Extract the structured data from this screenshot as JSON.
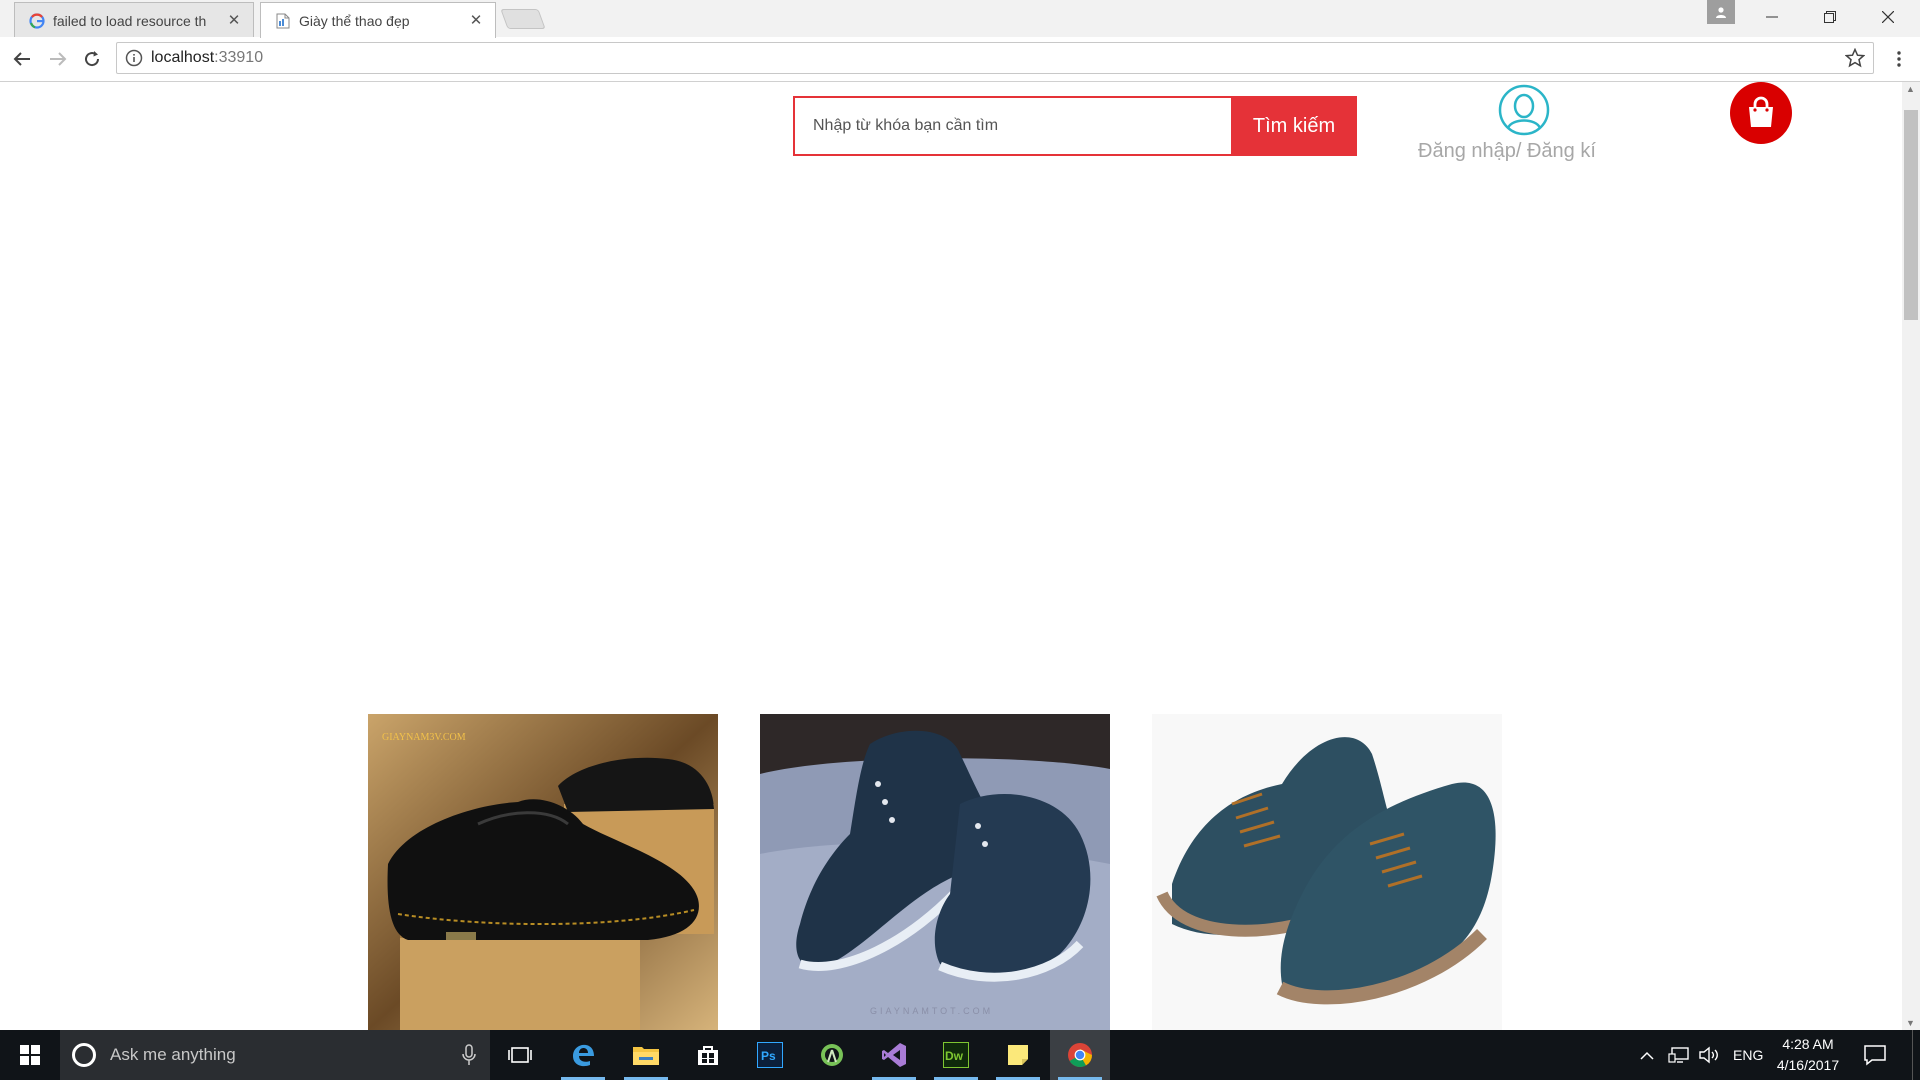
{
  "browser": {
    "tabs": [
      {
        "title": "failed to load resource th",
        "favicon": "google-g-icon",
        "active": false
      },
      {
        "title": "Giày thể thao đẹp",
        "favicon": "page-document-icon",
        "active": true
      }
    ],
    "address": {
      "host": "localhost",
      "port": ":33910"
    }
  },
  "header": {
    "search": {
      "placeholder": "Nhập từ khóa bạn cần tìm",
      "value": "",
      "button_label": "Tìm kiếm"
    },
    "account": {
      "label": "Đăng nhập/ Đăng kí",
      "icon": "user-outline-icon"
    },
    "cart": {
      "icon": "shopping-bag-icon"
    }
  },
  "products": [
    {
      "name": "black-leather-shoe",
      "watermark": "GIAYNAM3V.COM"
    },
    {
      "name": "blue-suede-shoe",
      "watermark": "GIAYNAMTOT.COM"
    },
    {
      "name": "teal-suede-shoe",
      "watermark": ""
    }
  ],
  "taskbar": {
    "search_placeholder": "Ask me anything",
    "apps": [
      "task-view-icon",
      "edge-icon",
      "file-explorer-icon",
      "store-icon",
      "photoshop-icon",
      "android-studio-icon",
      "visual-studio-icon",
      "dreamweaver-icon",
      "sticky-notes-icon",
      "chrome-icon"
    ],
    "language": "ENG",
    "time": "4:28 AM",
    "date": "4/16/2017"
  },
  "colors": {
    "accent_red": "#e53238",
    "cart_red": "#d90000",
    "account_teal": "#2bb5c8",
    "account_text": "#a7a7a7"
  }
}
